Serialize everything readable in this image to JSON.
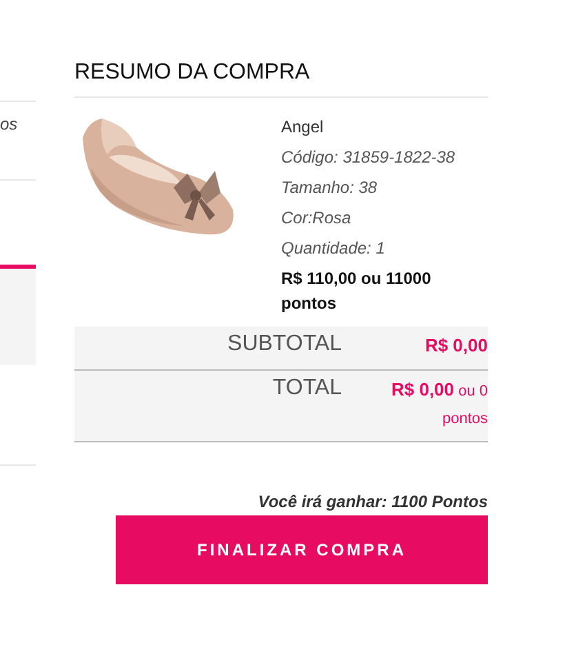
{
  "side_panel": {
    "fragment": "os"
  },
  "summary": {
    "title": "RESUMO DA COMPRA",
    "product": {
      "kind": "picture",
      "name": "Angel",
      "details": [
        "Código: 31859-1822-38",
        "Tamanho: 38",
        "Cor:Rosa",
        "Quantidade: 1"
      ],
      "price": "R$ 110,00 ou 11000 pontos"
    },
    "totals": [
      {
        "label": "SUBTOTAL",
        "value": "**R$ 0,00**"
      },
      {
        "label": "TOTAL",
        "value": "**R$ 0,00** ou 0 pontos"
      }
    ],
    "points_note": "Você irá ganhar: 1100 Pontos",
    "button": "FINALIZAR COMPRA"
  }
}
